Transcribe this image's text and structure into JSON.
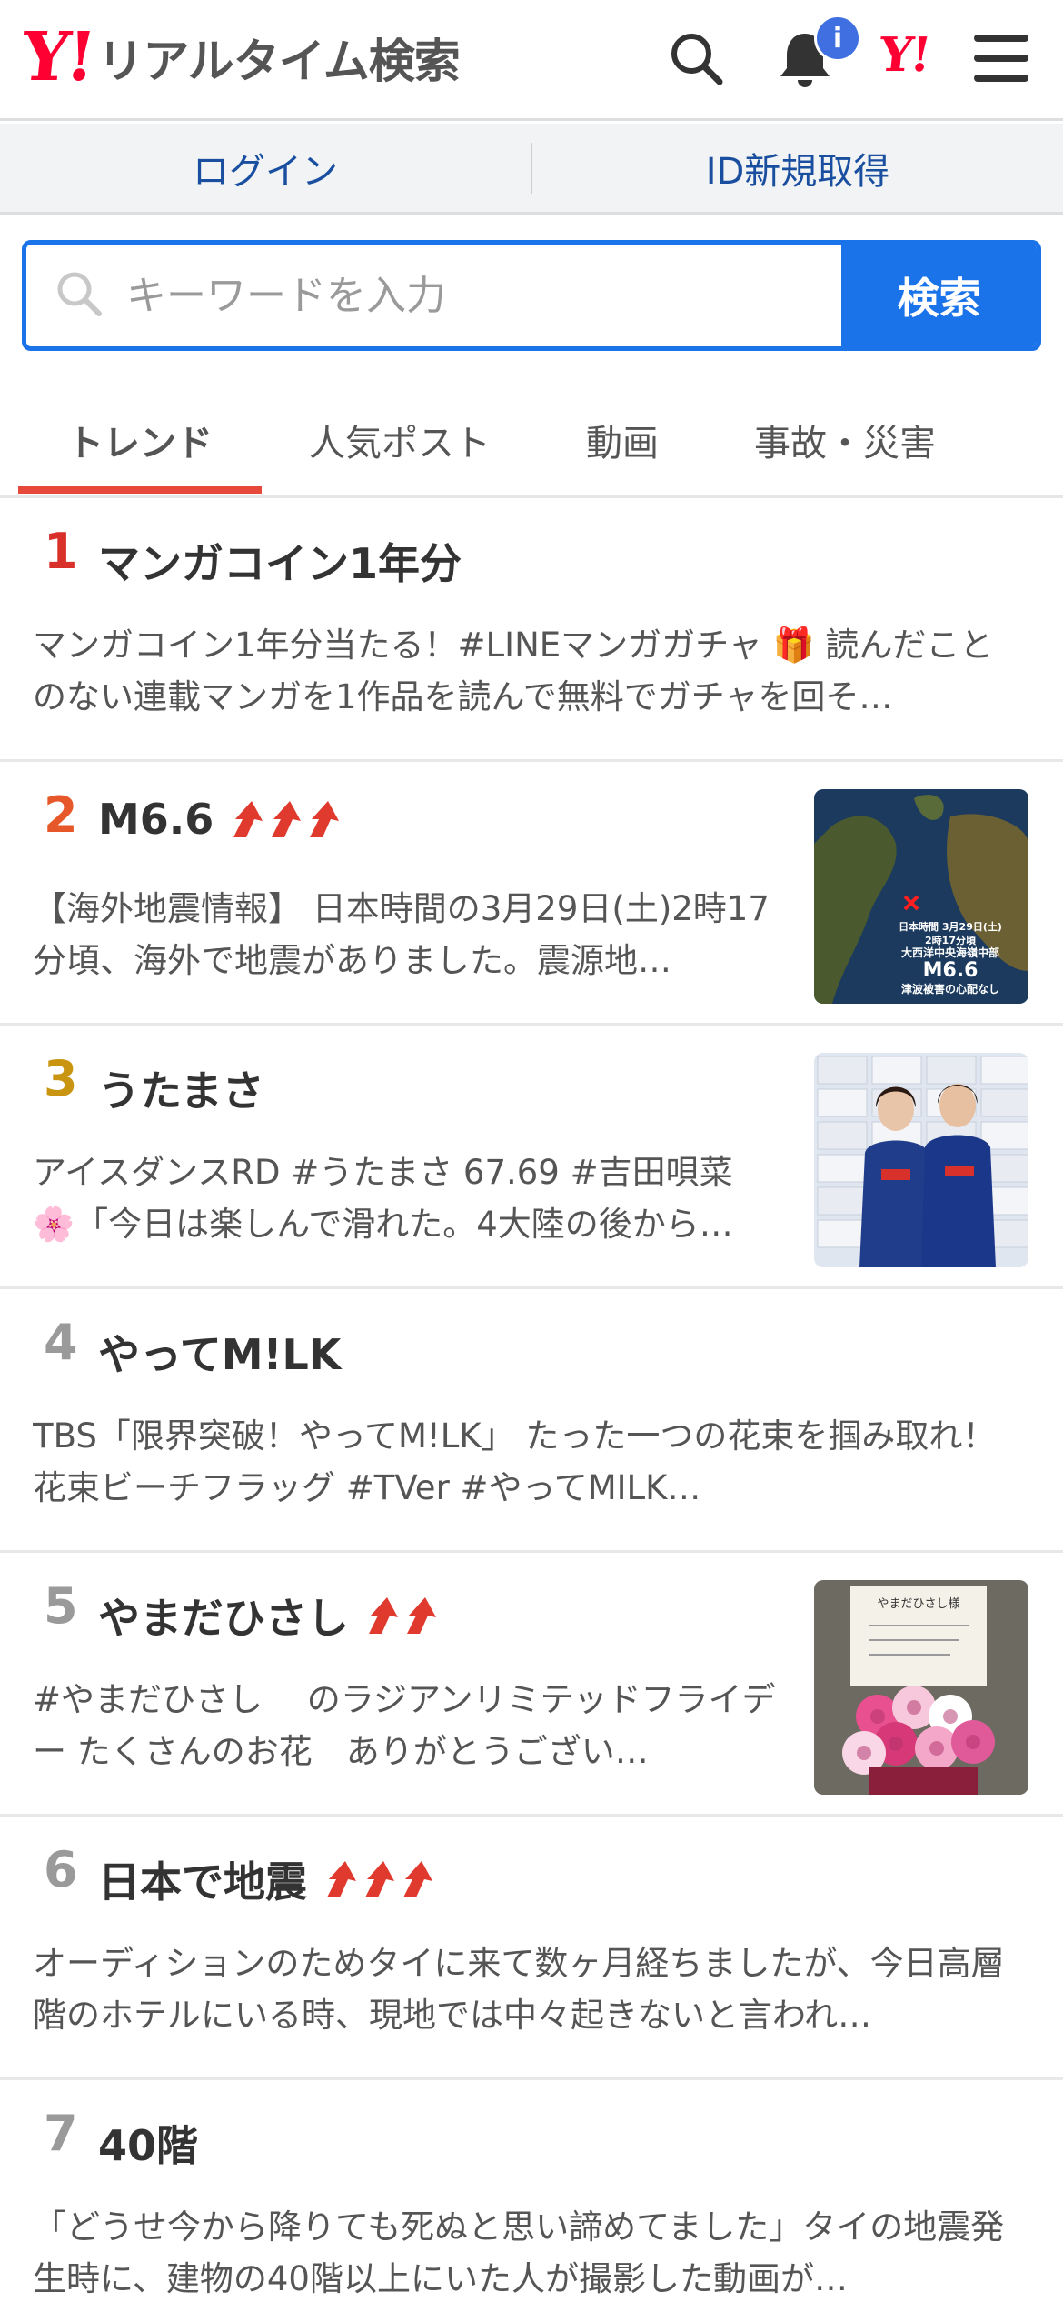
{
  "header": {
    "logo_y": "Y!",
    "logo_text": "リアルタイム検索",
    "notification_badge": "i",
    "yahoo_small": "Y!"
  },
  "login": {
    "login_label": "ログイン",
    "signup_label": "ID新規取得"
  },
  "search": {
    "placeholder": "キーワードを入力",
    "button_label": "検索"
  },
  "tabs": [
    {
      "label": "トレンド",
      "active": true
    },
    {
      "label": "人気ポスト"
    },
    {
      "label": "動画"
    },
    {
      "label": "事故・災害"
    }
  ],
  "items": [
    {
      "rank": "1",
      "rank_color": "#d9302a",
      "title": "マンガコイン1年分",
      "arrows": 0,
      "thumb": null,
      "desc": "マンガコイン1年分当たる！#LINEマンガガチャ 🎁 読んだことのない連載マンガを1作品を読んで無料でガチャを回そ…"
    },
    {
      "rank": "2",
      "rank_color": "#e6582a",
      "title": "M6.6",
      "arrows": 3,
      "thumb": "map",
      "thumb_text": [
        "日本時間 3月29日(土)",
        "2時17分頃",
        "大西洋中央海嶺中部",
        "M6.6",
        "津波被害の心配なし"
      ],
      "desc": "【海外地震情報】 日本時間の3月29日(土)2時17分頃、海外で地震がありました。震源地…"
    },
    {
      "rank": "3",
      "rank_color": "#c99410",
      "title": "うたまさ",
      "arrows": 0,
      "thumb": "skaters",
      "desc": "アイスダンスRD #うたまさ 67.69 #吉田唄菜 🌸「今日は楽しんで滑れた。4大陸の後から…"
    },
    {
      "rank": "4",
      "rank_color": "#9a9a9a",
      "title": "やってM!LK",
      "arrows": 0,
      "thumb": null,
      "desc": "TBS「限界突破！やってM!LK」 たった一つの花束を掴み取れ！花束ビーチフラッグ #TVer #やってMILK…"
    },
    {
      "rank": "5",
      "rank_color": "#9a9a9a",
      "title": "やまだひさし",
      "arrows": 2,
      "thumb": "flowers",
      "thumb_text": [
        "やまだひさし様"
      ],
      "desc": "#やまだひさし　 のラジアンリミテッドフライデー たくさんのお花　ありがとうござい…"
    },
    {
      "rank": "6",
      "rank_color": "#9a9a9a",
      "title": "日本で地震",
      "arrows": 3,
      "thumb": null,
      "desc": "オーディションのためタイに来て数ヶ月経ちましたが、今日高層階のホテルにいる時、現地では中々起きないと言われ…"
    },
    {
      "rank": "7",
      "rank_color": "#9a9a9a",
      "title": "40階",
      "arrows": 0,
      "thumb": null,
      "desc": "「どうせ今から降りても死ぬと思い諦めてました」タイの地震発生時に、建物の40階以上にいた人が撮影した動画が…"
    }
  ],
  "colors": {
    "accent_blue": "#1a73e8",
    "yahoo_red": "#ff0033",
    "tab_underline": "#e8483a",
    "arrow_red": "#e03a2f"
  }
}
